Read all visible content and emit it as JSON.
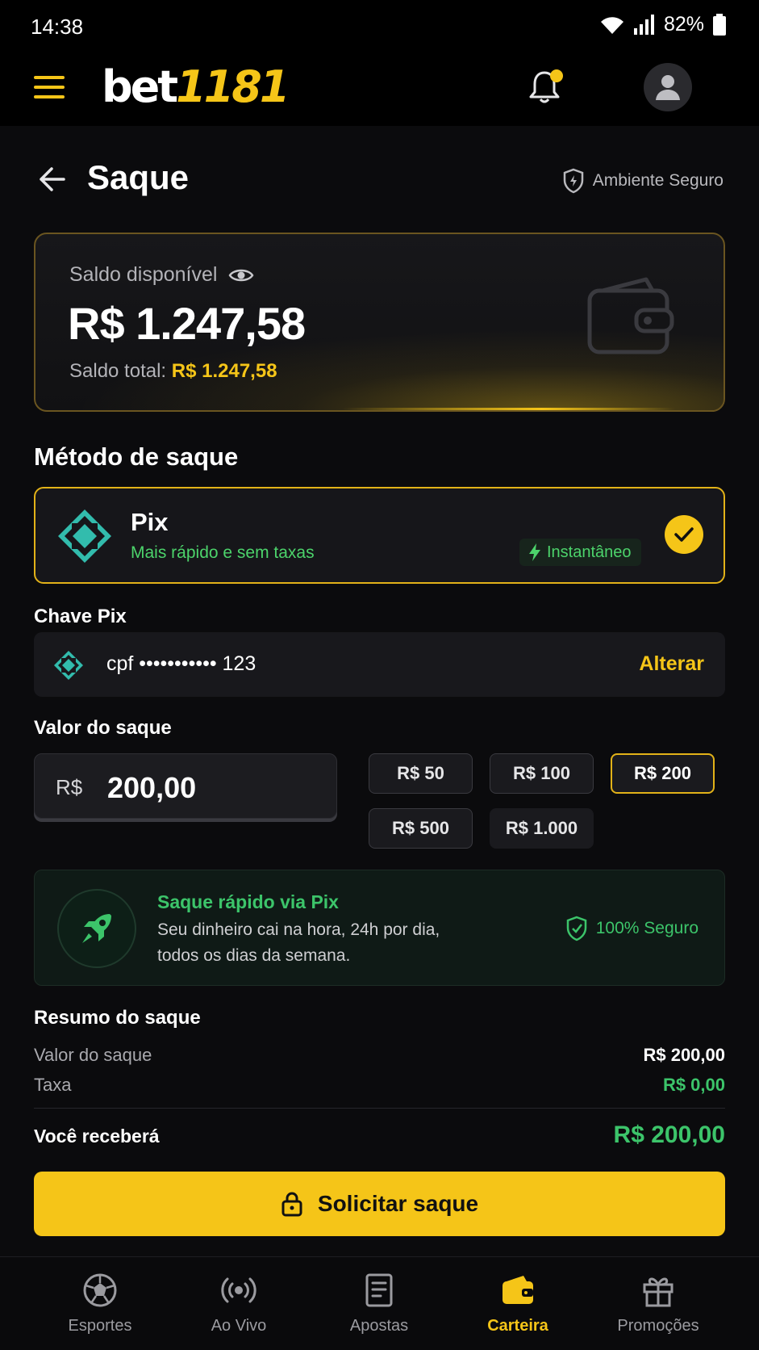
{
  "status": {
    "time": "14:38",
    "battery": "82%"
  },
  "header": {
    "logo_white": "bet",
    "logo_yellow": "1181"
  },
  "page": {
    "title": "Saque",
    "secure_label": "Ambiente Seguro"
  },
  "balance": {
    "label": "Saldo disponível",
    "value": "R$ 1.247,58",
    "total_label": "Saldo total:",
    "total_value": "R$ 1.247,58"
  },
  "method": {
    "section_title": "Método de saque",
    "name": "Pix",
    "subtitle": "Mais rápido e sem taxas",
    "badge": "Instantâneo"
  },
  "pix_key": {
    "label": "Chave Pix",
    "value": "cpf ••••••••••• 123",
    "change_label": "Alterar"
  },
  "amount": {
    "label": "Valor do saque",
    "currency": "R$",
    "value": "200,00",
    "chips": [
      "R$ 50",
      "R$ 100",
      "R$ 200",
      "R$ 500",
      "R$ 1.000"
    ],
    "selected_chip": "R$ 200"
  },
  "fast_banner": {
    "title": "Saque rápido via Pix",
    "text": "Seu dinheiro cai na hora, 24h por dia, todos os dias da semana.",
    "safe_label": "100% Seguro"
  },
  "summary": {
    "title": "Resumo do saque",
    "amount_label": "Valor do saque",
    "amount_value": "R$ 200,00",
    "fee_label": "Taxa",
    "fee_value": "R$ 0,00",
    "receive_label": "Você receberá",
    "receive_value": "R$ 200,00"
  },
  "cta": {
    "label": "Solicitar saque"
  },
  "nav": {
    "items": [
      {
        "label": "Esportes",
        "icon": "soccer-ball-icon"
      },
      {
        "label": "Ao Vivo",
        "icon": "live-broadcast-icon"
      },
      {
        "label": "Apostas",
        "icon": "bet-slip-icon"
      },
      {
        "label": "Carteira",
        "icon": "wallet-icon"
      },
      {
        "label": "Promoções",
        "icon": "gift-icon"
      }
    ],
    "active": "Carteira"
  },
  "colors": {
    "accent": "#f5c518",
    "success": "#3cc46a",
    "pix": "#32bcad",
    "background": "#0b0b0d"
  }
}
